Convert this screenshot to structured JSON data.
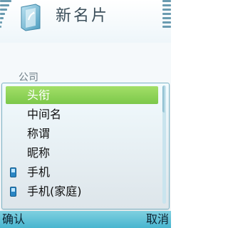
{
  "header": {
    "title": "新名片",
    "app_icon": "contact-card-icon",
    "signal_icon": "signal-strength-icon",
    "battery_icon": "battery-icon"
  },
  "form": {
    "field_label": "公司"
  },
  "popup": {
    "items": [
      {
        "label": "头衔",
        "icon": "",
        "selected": true
      },
      {
        "label": "中间名",
        "icon": "",
        "selected": false
      },
      {
        "label": "称谓",
        "icon": "",
        "selected": false
      },
      {
        "label": "昵称",
        "icon": "",
        "selected": false
      },
      {
        "label": "手机",
        "icon": "mobile-phone-icon",
        "selected": false
      },
      {
        "label": "手机(家庭)",
        "icon": "mobile-phone-icon",
        "selected": false
      }
    ]
  },
  "softkeys": {
    "left": "确认",
    "right": "取消"
  },
  "colors": {
    "selection": "#8ed456",
    "softkey_bar": "#5cc2d8",
    "popup_border": "#7fb5c7"
  }
}
